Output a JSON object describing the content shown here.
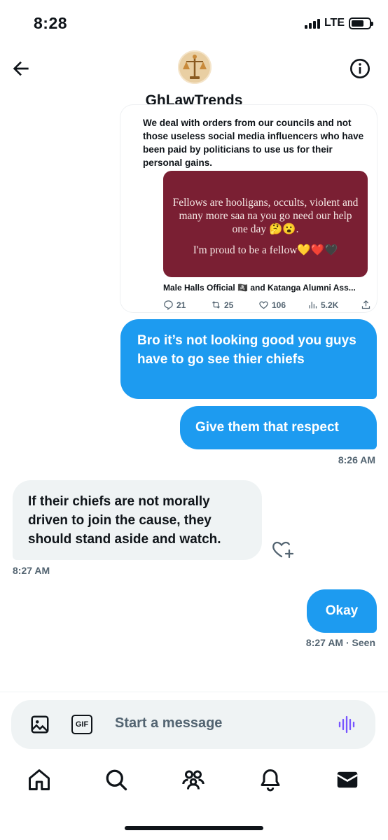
{
  "status_bar": {
    "time": "8:28",
    "network": "LTE"
  },
  "header": {
    "contact_name": "GhLawTrends",
    "avatar_icon": "justice-scale-avatar"
  },
  "shared_tweet": {
    "text": "We deal with orders from our councils and not those useless social media influencers who have been paid by politicians to use us for their personal gains.",
    "image_text_1": "Fellows are hooligans, occults, violent and many more saa na you go need our help one day 🤔😮.",
    "image_text_2": "I'm proud to be a fellow💛❤️🖤",
    "image_bg_color": "#7a1f33",
    "author_line": "Male Halls Official 🏴‍☠️ and Katanga Alumni Ass...",
    "stats": {
      "replies": "21",
      "reposts": "25",
      "likes": "106",
      "views": "5.2K"
    }
  },
  "messages": [
    {
      "direction": "sent",
      "text": "Bro it’s not looking good you guys have to go see thier chiefs"
    },
    {
      "direction": "sent",
      "text": "Give them that respect",
      "time": "8:26 AM"
    },
    {
      "direction": "received",
      "text": "If their chiefs are not morally driven to join the cause, they should stand aside and watch.",
      "time": "8:27 AM"
    },
    {
      "direction": "sent",
      "text": "Okay",
      "time": "8:27 AM",
      "status": "· Seen"
    }
  ],
  "composer": {
    "placeholder": "Start a message",
    "gif_label": "GIF"
  },
  "colors": {
    "accent": "#1d9bf0",
    "received_bubble": "#eff3f4",
    "voice_icon": "#7856ff"
  },
  "nav": [
    "home-icon",
    "search-icon",
    "communities-icon",
    "notifications-icon",
    "messages-icon"
  ]
}
